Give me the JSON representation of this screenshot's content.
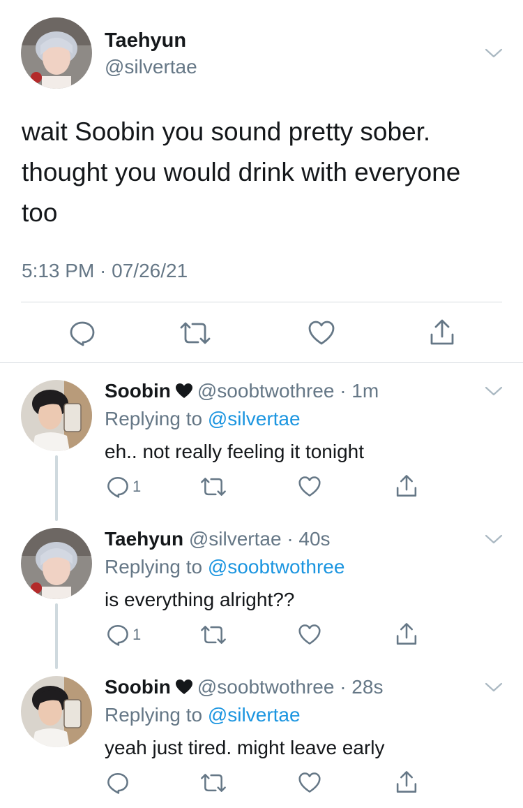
{
  "main_tweet": {
    "name": "Taehyun",
    "handle": "@silvertae",
    "text": "wait Soobin you sound pretty sober. thought you would drink with everyone too",
    "timestamp": "5:13 PM · 07/26/21",
    "icons": [
      "reply-icon",
      "retweet-icon",
      "like-icon",
      "share-icon"
    ]
  },
  "replies": [
    {
      "name": "Soobin",
      "name_icon": "black-heart-icon",
      "handle": "@soobtwothree",
      "time": "· 1m",
      "replying_prefix": "Replying to ",
      "replying_to": "@silvertae",
      "text": "eh.. not really feeling it tonight",
      "reply_count": "1"
    },
    {
      "name": "Taehyun",
      "handle": "@silvertae",
      "time": "· 40s",
      "replying_prefix": "Replying to ",
      "replying_to": "@soobtwothree",
      "text": "is everything alright??",
      "reply_count": "1"
    },
    {
      "name": "Soobin",
      "name_icon": "black-heart-icon",
      "handle": "@soobtwothree",
      "time": "· 28s",
      "replying_prefix": "Replying to ",
      "replying_to": "@silvertae",
      "text": "yeah just tired. might leave early",
      "reply_count": ""
    }
  ],
  "colors": {
    "text": "#14171a",
    "secondary": "#657786",
    "link": "#1b95e0",
    "divider": "#d6dbdf"
  }
}
